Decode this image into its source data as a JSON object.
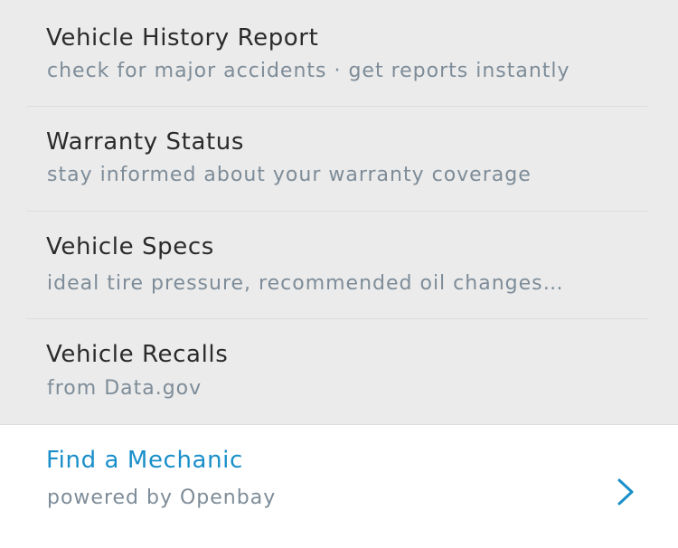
{
  "items": [
    {
      "title": "Vehicle History Report",
      "subtitle": "check for major accidents · get reports instantly"
    },
    {
      "title": "Warranty Status",
      "subtitle": "stay informed about your warranty coverage"
    },
    {
      "title": "Vehicle Specs",
      "subtitle": "ideal tire pressure, recommended oil changes…"
    },
    {
      "title": "Vehicle Recalls",
      "subtitle": "from Data.gov"
    }
  ],
  "mechanic": {
    "title": "Find a Mechanic",
    "subtitle": "powered by Openbay",
    "icon": "chevron-right-icon",
    "accent_color": "#1a8fc9"
  }
}
